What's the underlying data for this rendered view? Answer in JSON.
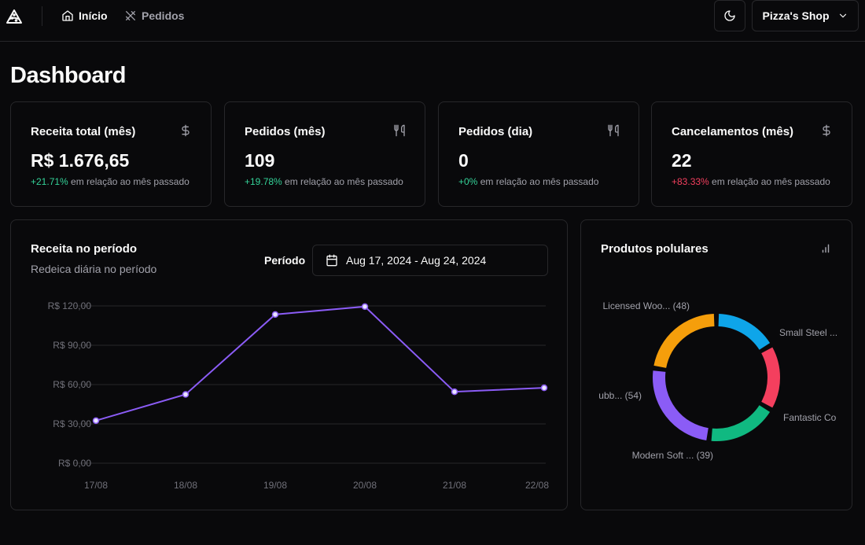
{
  "header": {
    "logo_icon": "pizza-icon",
    "nav": [
      {
        "label": "Início",
        "icon": "home-icon",
        "active": true
      },
      {
        "label": "Pedidos",
        "icon": "utensils-icon",
        "active": false
      }
    ],
    "theme_icon": "moon-icon",
    "shop_name": "Pizza's Shop",
    "shop_icon": "chevron-down-icon"
  },
  "page": {
    "title": "Dashboard"
  },
  "stats": [
    {
      "title": "Receita total (mês)",
      "icon": "dollar-icon",
      "value": "R$ 1.676,65",
      "change": "+21.71%",
      "change_type": "positive",
      "note": " em relação ao mês passado"
    },
    {
      "title": "Pedidos (mês)",
      "icon": "utensils-icon",
      "value": "109",
      "change": "+19.78%",
      "change_type": "positive",
      "note": " em relação ao mês passado"
    },
    {
      "title": "Pedidos (dia)",
      "icon": "utensils-icon",
      "value": "0",
      "change": "+0%",
      "change_type": "positive",
      "note": " em relação ao mês passado"
    },
    {
      "title": "Cancelamentos (mês)",
      "icon": "dollar-icon",
      "value": "22",
      "change": "+83.33%",
      "change_type": "negative",
      "note": " em relação ao mês passado"
    }
  ],
  "revenue": {
    "title": "Receita no período",
    "subtitle": "Redeica diária no período",
    "period_label": "Período",
    "date_range": "Aug 17, 2024 - Aug 24, 2024",
    "calendar_icon": "calendar-icon"
  },
  "popular": {
    "title": "Produtos polulares",
    "icon": "bar-chart-icon"
  },
  "colors": {
    "accent": "#8b5cf6",
    "positive": "#34d399",
    "negative": "#f43f5e",
    "slices": [
      "#0ea5e9",
      "#f43f5e",
      "#10b981",
      "#8b5cf6",
      "#f59e0b"
    ]
  },
  "chart_data": [
    {
      "type": "line",
      "x": [
        "17/08",
        "18/08",
        "19/08",
        "20/08",
        "21/08",
        "22/08"
      ],
      "series": [
        {
          "values": [
            32.5,
            52.5,
            113.5,
            119.5,
            54.5,
            57.5
          ]
        }
      ],
      "y_ticks": [
        "R$ 0,00",
        "R$ 30,00",
        "R$ 60,00",
        "R$ 90,00",
        "R$ 120,00"
      ],
      "ylim": [
        0,
        120
      ],
      "grid": true,
      "title": "",
      "xlabel": "",
      "ylabel": ""
    },
    {
      "type": "pie",
      "categories": [
        "Small Steel ...",
        "Fantastic Co",
        "Modern Soft ... (39)",
        "ubb... (54)",
        "Licensed Woo... (48)"
      ],
      "values": [
        35,
        36,
        39,
        54,
        48
      ],
      "title": ""
    }
  ]
}
